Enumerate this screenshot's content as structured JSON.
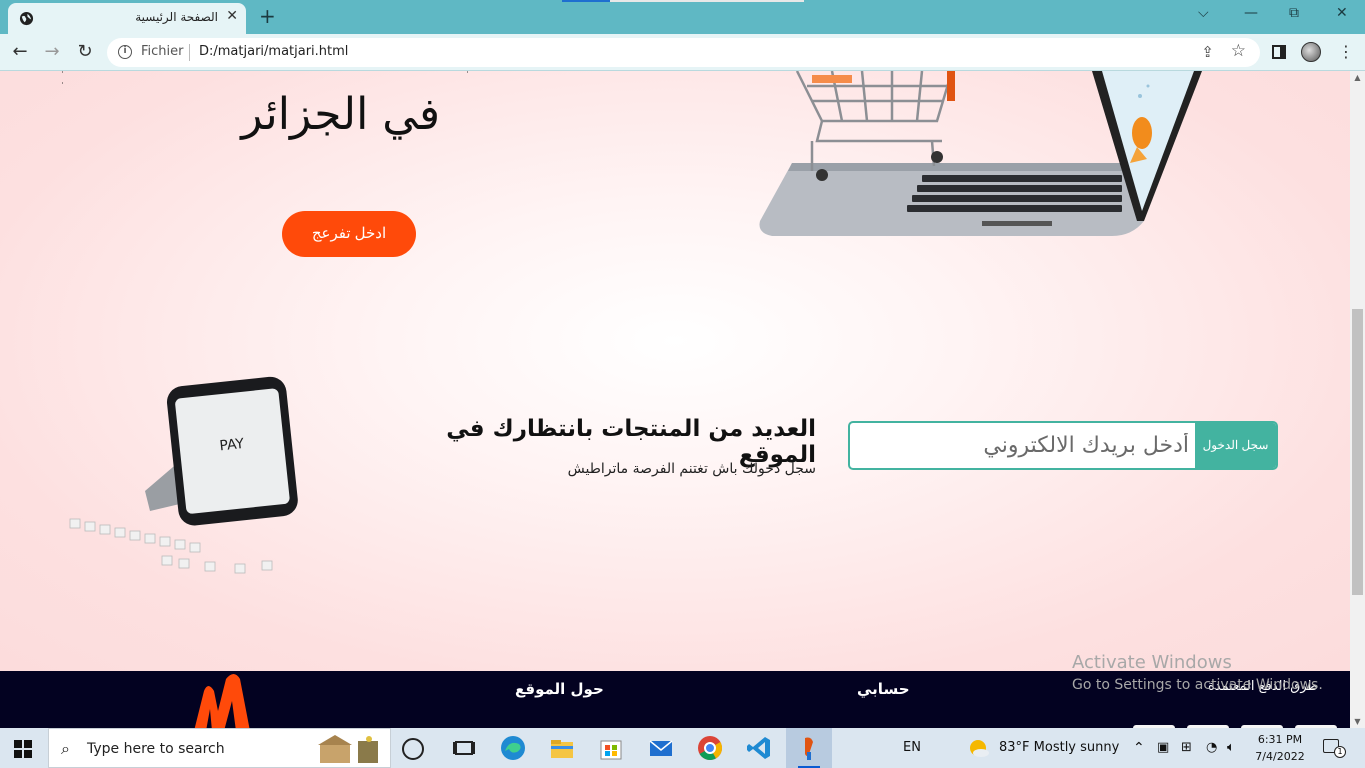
{
  "browser": {
    "tab_title": "الصفحة الرئيسية",
    "tab_close": "✕",
    "new_tab": "+",
    "window_controls": {
      "dropdown": "⌵",
      "minimize": "—",
      "restore": "⧉",
      "close": "✕"
    },
    "nav": {
      "back": "←",
      "forward": "→",
      "reload": "↻"
    },
    "address": {
      "scheme_label": "Fichier",
      "url": "D:/matjari/matjari.html"
    },
    "menu": "⋮"
  },
  "hero": {
    "title": "في الجزائر",
    "cta_label": "ادخل تفرعج"
  },
  "promo": {
    "title": "العديد من المنتجات بانتظارك في الموقع",
    "subtitle": "سجل دخولك باش تغتنم الفرصة ماتراطيش"
  },
  "signup": {
    "placeholder": "أدخل بريدك الالكتروني",
    "button_label": "سجل الدخول"
  },
  "footer": {
    "about": "حول الموقع",
    "account": "حسابي",
    "payment_methods": "طرق الدفع المعتمدة"
  },
  "watermark": {
    "line1": "Activate Windows",
    "line2": "Go to Settings to activate Windows."
  },
  "taskbar": {
    "search_placeholder": "Type here to search",
    "language": "EN",
    "weather": "83°F  Mostly sunny",
    "time": "6:31 PM",
    "date": "7/4/2022",
    "notification_count": "1"
  },
  "colors": {
    "accent_orange": "#ff4a0a",
    "accent_teal": "#43b3a0",
    "footer_bg": "#030221",
    "tabbar": "#5fb8c4"
  }
}
